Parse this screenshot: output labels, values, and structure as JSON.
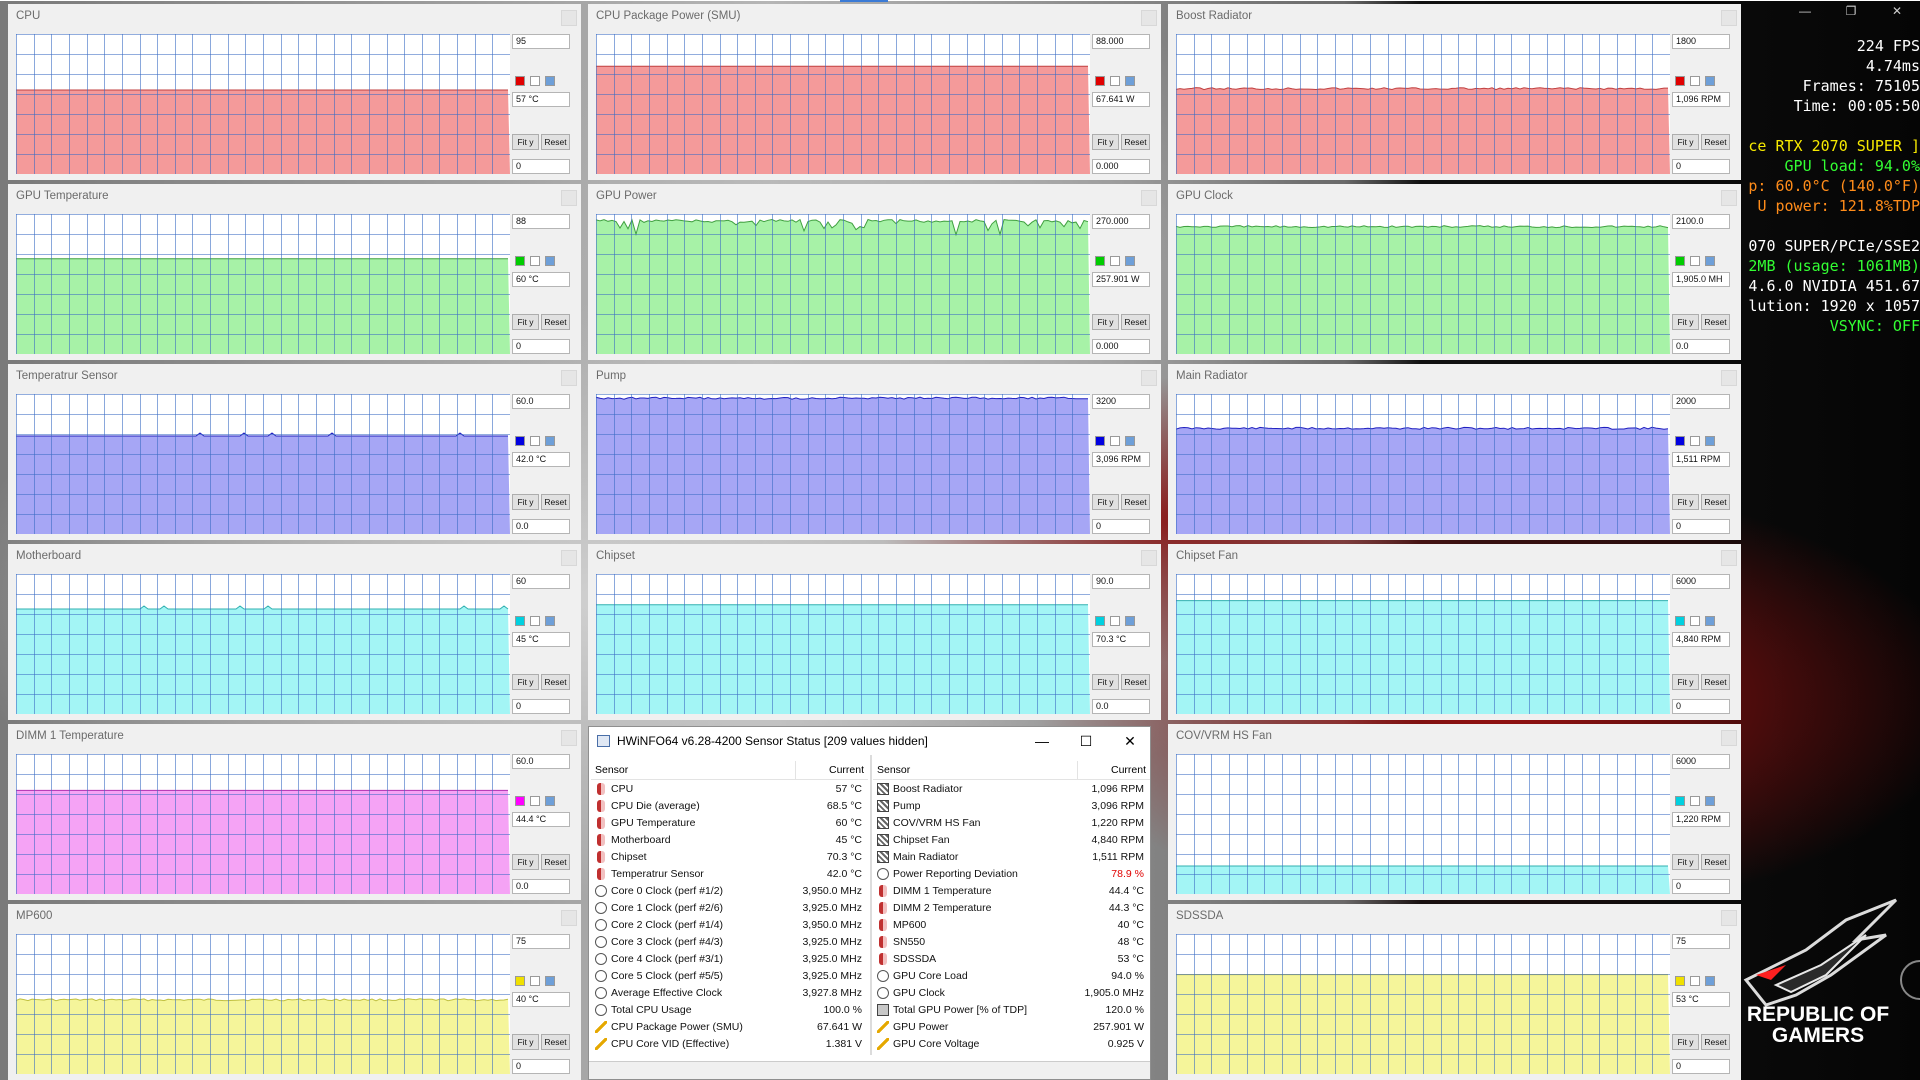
{
  "panels": [
    {
      "title": "CPU",
      "max": "95",
      "current": "57 °C",
      "min": "0",
      "color": "#f49a9a",
      "dark": "#c04040",
      "swatch": "#e00000",
      "level": 0.6,
      "noise": "flat",
      "col": 0,
      "row": 0
    },
    {
      "title": "CPU Package Power (SMU)",
      "max": "88.000",
      "current": "67.641 W",
      "min": "0.000",
      "color": "#f49a9a",
      "dark": "#c04040",
      "swatch": "#e00000",
      "level": 0.77,
      "noise": "flat",
      "col": 1,
      "row": 0
    },
    {
      "title": "Boost Radiator",
      "max": "1800",
      "current": "1,096 RPM",
      "min": "0",
      "color": "#f49a9a",
      "dark": "#c04040",
      "swatch": "#e00000",
      "level": 0.61,
      "noise": "fine",
      "col": 2,
      "row": 0
    },
    {
      "title": "GPU Temperature",
      "max": "88",
      "current": "60 °C",
      "min": "0",
      "color": "#a7f2a7",
      "dark": "#40a040",
      "swatch": "#00cc00",
      "level": 0.68,
      "noise": "flat",
      "col": 0,
      "row": 1
    },
    {
      "title": "GPU Power",
      "max": "270.000",
      "current": "257.901 W",
      "min": "0.000",
      "color": "#a7f2a7",
      "dark": "#40a040",
      "swatch": "#00cc00",
      "level": 0.95,
      "noise": "spiky",
      "col": 1,
      "row": 1
    },
    {
      "title": "GPU Clock",
      "max": "2100.0",
      "current": "1,905.0 MH",
      "min": "0.0",
      "color": "#a7f2a7",
      "dark": "#40a040",
      "swatch": "#00cc00",
      "level": 0.91,
      "noise": "fine",
      "col": 2,
      "row": 1
    },
    {
      "title": "Temperatrur Sensor",
      "max": "60.0",
      "current": "42.0 °C",
      "min": "0.0",
      "color": "#a6a6f5",
      "dark": "#2020c0",
      "swatch": "#0000e0",
      "level": 0.7,
      "noise": "blips",
      "col": 0,
      "row": 2
    },
    {
      "title": "Pump",
      "max": "3200",
      "current": "3,096 RPM",
      "min": "0",
      "color": "#a6a6f5",
      "dark": "#2020c0",
      "swatch": "#0000e0",
      "level": 0.97,
      "noise": "fine",
      "col": 1,
      "row": 2
    },
    {
      "title": "Main Radiator",
      "max": "2000",
      "current": "1,511 RPM",
      "min": "0",
      "color": "#a6a6f5",
      "dark": "#2020c0",
      "swatch": "#0000e0",
      "level": 0.755,
      "noise": "fine",
      "col": 2,
      "row": 2
    },
    {
      "title": "Motherboard",
      "max": "60",
      "current": "45 °C",
      "min": "0",
      "color": "#a3f5f5",
      "dark": "#30b0b0",
      "swatch": "#00d0e0",
      "level": 0.75,
      "noise": "blips",
      "col": 0,
      "row": 3
    },
    {
      "title": "Chipset",
      "max": "90.0",
      "current": "70.3 °C",
      "min": "0.0",
      "color": "#a3f5f5",
      "dark": "#30b0b0",
      "swatch": "#00d0e0",
      "level": 0.78,
      "noise": "flat",
      "col": 1,
      "row": 3
    },
    {
      "title": "Chipset Fan",
      "max": "6000",
      "current": "4,840 RPM",
      "min": "0",
      "color": "#a3f5f5",
      "dark": "#30b0b0",
      "swatch": "#00d0e0",
      "level": 0.81,
      "noise": "flat",
      "col": 2,
      "row": 3
    },
    {
      "title": "DIMM 1 Temperature",
      "max": "60.0",
      "current": "44.4 °C",
      "min": "0.0",
      "color": "#f5a3f5",
      "dark": "#b030b0",
      "swatch": "#ff00ff",
      "level": 0.74,
      "noise": "flat",
      "col": 0,
      "row": 4
    },
    {
      "title": "COV/VRM HS Fan",
      "max": "6000",
      "current": "1,220 RPM",
      "min": "0",
      "color": "#a3f5f5",
      "dark": "#30b0b0",
      "swatch": "#00d0e0",
      "level": 0.2,
      "noise": "flat",
      "col": 2,
      "row": 4
    },
    {
      "title": "MP600",
      "max": "75",
      "current": "40 °C",
      "min": "0",
      "color": "#f5f59a",
      "dark": "#c0c040",
      "swatch": "#f0e000",
      "level": 0.53,
      "noise": "fine",
      "col": 0,
      "row": 5
    },
    {
      "title": "SDSSDA",
      "max": "75",
      "current": "53 °C",
      "min": "0",
      "color": "#f5f59a",
      "dark": "#c0c040",
      "swatch": "#f0e000",
      "level": 0.71,
      "noise": "flat",
      "col": 2,
      "row": 5
    }
  ],
  "buttons": {
    "fit": "Fit y",
    "reset": "Reset"
  },
  "osd": [
    {
      "text": "224 FPS",
      "cls": "w"
    },
    {
      "text": "4.74ms",
      "cls": "w"
    },
    {
      "text": "Frames: 75105",
      "cls": "w"
    },
    {
      "text": "Time: 00:05:50",
      "cls": "w"
    },
    {
      "text": "",
      "cls": "w"
    },
    {
      "text": "ce RTX 2070 SUPER ]",
      "cls": "y"
    },
    {
      "text": "GPU load: 94.0%",
      "cls": "g"
    },
    {
      "text": "p: 60.0°C (140.0°F)",
      "cls": "o"
    },
    {
      "text": "U power: 121.8%TDP",
      "cls": "o"
    },
    {
      "text": "",
      "cls": "w"
    },
    {
      "text": "070 SUPER/PCIe/SSE2",
      "cls": "w"
    },
    {
      "text": "2MB (usage: 1061MB)",
      "cls": "g"
    },
    {
      "text": "4.6.0 NVIDIA 451.67",
      "cls": "w"
    },
    {
      "text": "lution: 1920 x 1057",
      "cls": "w"
    },
    {
      "text": "VSYNC: OFF",
      "cls": "g"
    }
  ],
  "rog": {
    "line1": "REPUBLIC OF",
    "line2": "GAMERS"
  },
  "hwinfo": {
    "title": "HWiNFO64 v6.28-4200 Sensor Status [209 values hidden]",
    "col_sensor": "Sensor",
    "col_current": "Current",
    "left": [
      {
        "name": "CPU",
        "value": "57 °C",
        "icon": "therm"
      },
      {
        "name": "CPU Die (average)",
        "value": "68.5 °C",
        "icon": "therm"
      },
      {
        "name": "GPU Temperature",
        "value": "60 °C",
        "icon": "therm"
      },
      {
        "name": "Motherboard",
        "value": "45 °C",
        "icon": "therm"
      },
      {
        "name": "Chipset",
        "value": "70.3 °C",
        "icon": "therm"
      },
      {
        "name": "Temperatrur Sensor",
        "value": "42.0 °C",
        "icon": "therm"
      },
      {
        "name": "Core 0 Clock (perf #1/2)",
        "value": "3,950.0 MHz",
        "icon": "clock"
      },
      {
        "name": "Core 1 Clock (perf #2/6)",
        "value": "3,925.0 MHz",
        "icon": "clock"
      },
      {
        "name": "Core 2 Clock (perf #1/4)",
        "value": "3,950.0 MHz",
        "icon": "clock"
      },
      {
        "name": "Core 3 Clock (perf #4/3)",
        "value": "3,925.0 MHz",
        "icon": "clock"
      },
      {
        "name": "Core 4 Clock (perf #3/1)",
        "value": "3,925.0 MHz",
        "icon": "clock"
      },
      {
        "name": "Core 5 Clock (perf #5/5)",
        "value": "3,925.0 MHz",
        "icon": "clock"
      },
      {
        "name": "Average Effective Clock",
        "value": "3,927.8 MHz",
        "icon": "clock"
      },
      {
        "name": "Total CPU Usage",
        "value": "100.0 %",
        "icon": "clock"
      },
      {
        "name": "CPU Package Power (SMU)",
        "value": "67.641 W",
        "icon": "bolt"
      },
      {
        "name": "CPU Core VID (Effective)",
        "value": "1.381 V",
        "icon": "bolt"
      }
    ],
    "right": [
      {
        "name": "Boost Radiator",
        "value": "1,096 RPM",
        "icon": "fan",
        "red": false
      },
      {
        "name": "Pump",
        "value": "3,096 RPM",
        "icon": "fan",
        "red": false
      },
      {
        "name": "COV/VRM HS Fan",
        "value": "1,220 RPM",
        "icon": "fan",
        "red": false
      },
      {
        "name": "Chipset Fan",
        "value": "4,840 RPM",
        "icon": "fan",
        "red": false
      },
      {
        "name": "Main Radiator",
        "value": "1,511 RPM",
        "icon": "fan",
        "red": false
      },
      {
        "name": "Power Reporting Deviation",
        "value": "78.9 %",
        "icon": "clock",
        "red": true
      },
      {
        "name": "DIMM 1 Temperature",
        "value": "44.4 °C",
        "icon": "therm",
        "red": false
      },
      {
        "name": "DIMM 2 Temperature",
        "value": "44.3 °C",
        "icon": "therm",
        "red": false
      },
      {
        "name": "MP600",
        "value": "40 °C",
        "icon": "therm",
        "red": false
      },
      {
        "name": "SN550",
        "value": "48 °C",
        "icon": "therm",
        "red": false
      },
      {
        "name": "SDSSDA",
        "value": "53 °C",
        "icon": "therm",
        "red": false
      },
      {
        "name": "GPU Core Load",
        "value": "94.0 %",
        "icon": "clock",
        "red": false
      },
      {
        "name": "GPU Clock",
        "value": "1,905.0 MHz",
        "icon": "clock",
        "red": false
      },
      {
        "name": "Total GPU Power [% of TDP]",
        "value": "120.0 %",
        "icon": "chip",
        "red": false
      },
      {
        "name": "GPU Power",
        "value": "257.901 W",
        "icon": "bolt",
        "red": false
      },
      {
        "name": "GPU Core Voltage",
        "value": "0.925 V",
        "icon": "bolt",
        "red": false
      }
    ]
  }
}
